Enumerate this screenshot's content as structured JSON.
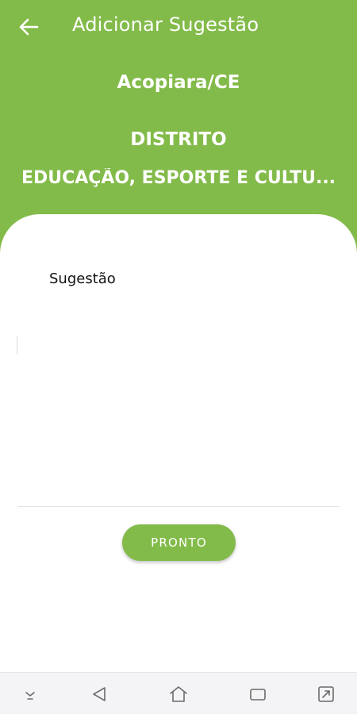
{
  "appbar": {
    "title": "Adicionar Sugestão",
    "back_icon": "arrow-left-icon"
  },
  "header": {
    "city": "Acopiara/CE",
    "district": "DISTRITO",
    "category": "EDUCAÇÃO, ESPORTE E CULTU..."
  },
  "form": {
    "suggestion_label": "Sugestão",
    "suggestion_value": "",
    "done_label": "PRONTO"
  },
  "navbar": {
    "items": [
      "keyboard-hide-icon",
      "back-triangle-icon",
      "home-icon",
      "recents-icon",
      "rotate-screen-icon"
    ]
  },
  "colors": {
    "primary": "#83bb4a",
    "on_primary": "#ffffff",
    "background": "#ffffff",
    "navbar": "#f4f4f6"
  }
}
